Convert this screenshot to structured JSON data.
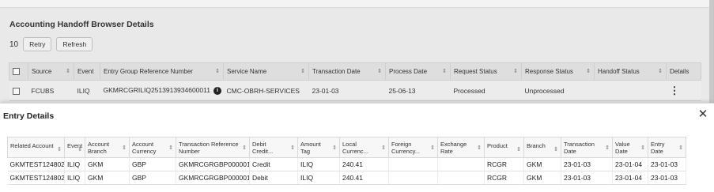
{
  "background_page": {
    "title": "Accounting Handoff Browser Details",
    "count": "10",
    "retry_label": "Retry",
    "refresh_label": "Refresh",
    "columns": [
      "Source",
      "Event",
      "Entry Group Reference Number",
      "Service Name",
      "Transaction Date",
      "Process Date",
      "Request Status",
      "Response Status",
      "Handoff Status",
      "Details"
    ],
    "row": {
      "source": "FCUBS",
      "event": "ILIQ",
      "entry_group_ref": "GKMRCGRILIQ2513913934600011",
      "service_name": "CMC-OBRH-SERVICES",
      "transaction_date": "23-01-03",
      "process_date": "25-06-13",
      "request_status": "Processed",
      "response_status": "Unprocessed",
      "handoff_status": ""
    }
  },
  "dialog": {
    "title": "Entry Details",
    "close_icon": "close-icon",
    "columns": [
      {
        "label": "Related Account"
      },
      {
        "label": "Event"
      },
      {
        "label": "Account Branch"
      },
      {
        "label": "Account Currency"
      },
      {
        "label": "Transaction Reference Number"
      },
      {
        "label": "Debit Credit..."
      },
      {
        "label": "Amount Tag"
      },
      {
        "label": "Local Currenc..."
      },
      {
        "label": "Foreign Currency..."
      },
      {
        "label": "Exchange Rate"
      },
      {
        "label": "Product"
      },
      {
        "label": "Branch"
      },
      {
        "label": "Transaction Date"
      },
      {
        "label": "Value Date"
      },
      {
        "label": "Entry Date"
      }
    ],
    "rows": [
      [
        "GKMTEST124802",
        "ILIQ",
        "GKM",
        "GBP",
        "GKMRCGRGBP000001",
        "Credit",
        "ILIQ",
        "240.41",
        "",
        "",
        "RCGR",
        "GKM",
        "23-01-03",
        "23-01-04",
        "23-01-03"
      ],
      [
        "GKMTEST124802",
        "ILIQ",
        "GKM",
        "GBP",
        "GKMRCGRGBP000001",
        "Debit",
        "ILIQ",
        "240.41",
        "",
        "",
        "RCGR",
        "GKM",
        "23-01-03",
        "23-01-04",
        "23-01-03"
      ]
    ]
  }
}
